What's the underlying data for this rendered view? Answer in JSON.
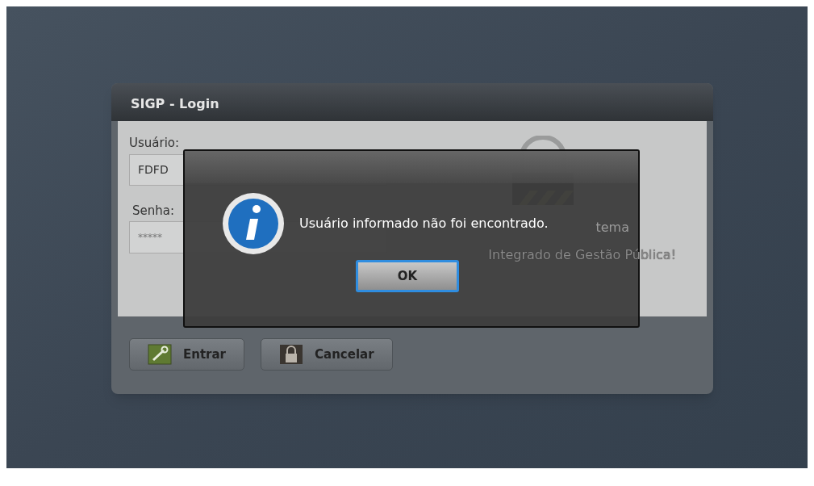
{
  "window": {
    "title": "SIGP - Login"
  },
  "form": {
    "user_label": "Usuário:",
    "user_value": "FDFD",
    "password_label": "Senha:",
    "password_value": "*****"
  },
  "welcome": {
    "line_1": "tema",
    "line_2": "Integrado de Gestão Pública!"
  },
  "buttons": [
    {
      "kind": "enter",
      "label": "Entrar"
    },
    {
      "kind": "cancel",
      "label": "Cancelar"
    }
  ],
  "dialog": {
    "message": "Usuário informado não foi encontrado.",
    "button": {
      "label": "OK",
      "focused": true
    }
  }
}
